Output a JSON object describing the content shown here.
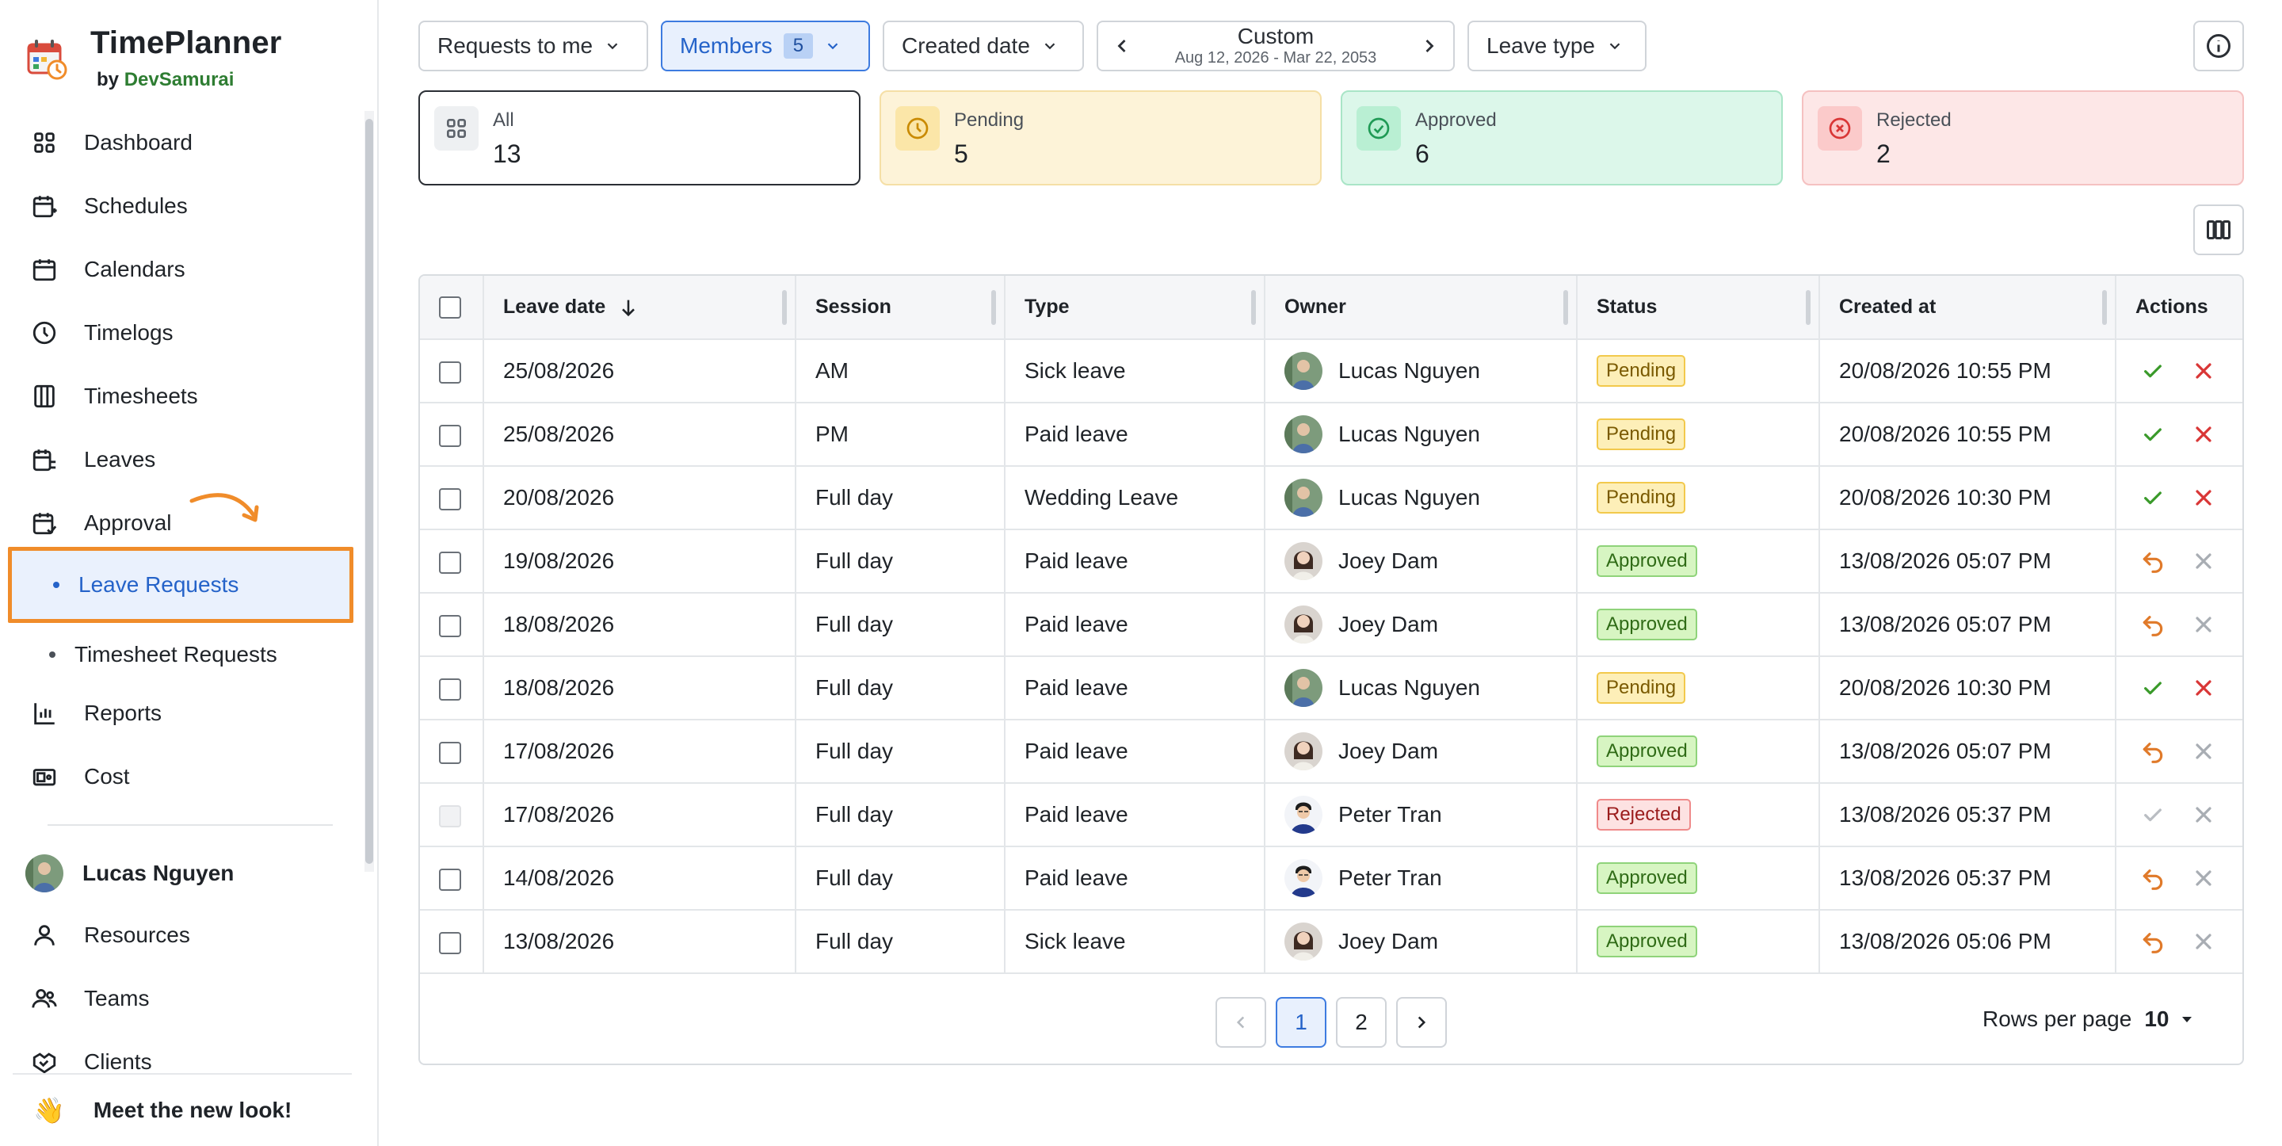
{
  "app": {
    "name": "TimePlanner",
    "by_prefix": "by",
    "by_brand": "DevSamurai"
  },
  "sidebar": {
    "items": [
      {
        "label": "Dashboard",
        "icon": "grid-icon"
      },
      {
        "label": "Schedules",
        "icon": "calendar-plus-icon"
      },
      {
        "label": "Calendars",
        "icon": "calendar-icon"
      },
      {
        "label": "Timelogs",
        "icon": "clock-icon"
      },
      {
        "label": "Timesheets",
        "icon": "columns-icon"
      },
      {
        "label": "Leaves",
        "icon": "calendar-leave-icon"
      },
      {
        "label": "Approval",
        "icon": "calendar-check-icon"
      }
    ],
    "sub_items": [
      {
        "label": "Leave Requests",
        "active": true
      },
      {
        "label": "Timesheet Requests",
        "active": false
      }
    ],
    "items2": [
      {
        "label": "Reports",
        "icon": "bar-chart-icon"
      },
      {
        "label": "Cost",
        "icon": "money-icon"
      }
    ],
    "user": {
      "name": "Lucas Nguyen"
    },
    "items3": [
      {
        "label": "Resources",
        "icon": "person-icon"
      },
      {
        "label": "Teams",
        "icon": "people-icon"
      },
      {
        "label": "Clients",
        "icon": "handshake-icon"
      }
    ],
    "new_look": "Meet the new look!",
    "new_look_emoji": "👋"
  },
  "filters": {
    "requests": "Requests to me",
    "members": "Members",
    "members_count": "5",
    "created_date": "Created date",
    "date_label": "Custom",
    "date_range": "Aug 12, 2026 - Mar 22, 2053",
    "leave_type": "Leave type"
  },
  "stats": [
    {
      "label": "All",
      "value": "13",
      "color": "#ffffff",
      "border": "#2b2f35"
    },
    {
      "label": "Pending",
      "value": "5",
      "color": "#fdf3d8",
      "border": "#f5dfa6"
    },
    {
      "label": "Approved",
      "value": "6",
      "color": "#dcf7ea",
      "border": "#a9e5c7"
    },
    {
      "label": "Rejected",
      "value": "2",
      "color": "#fde7e7",
      "border": "#f5c1c1"
    }
  ],
  "table": {
    "headers": {
      "leave_date": "Leave date",
      "session": "Session",
      "type": "Type",
      "owner": "Owner",
      "status": "Status",
      "created_at": "Created at",
      "actions": "Actions"
    },
    "rows": [
      {
        "leave_date": "25/08/2026",
        "session": "AM",
        "type": "Sick leave",
        "owner": "Lucas Nguyen",
        "avatar": "lucas",
        "status": "Pending",
        "created_at": "20/08/2026 10:55 PM",
        "actions": "approve-reject",
        "disabled": false
      },
      {
        "leave_date": "25/08/2026",
        "session": "PM",
        "type": "Paid leave",
        "owner": "Lucas Nguyen",
        "avatar": "lucas",
        "status": "Pending",
        "created_at": "20/08/2026 10:55 PM",
        "actions": "approve-reject",
        "disabled": false
      },
      {
        "leave_date": "20/08/2026",
        "session": "Full day",
        "type": "Wedding Leave",
        "owner": "Lucas Nguyen",
        "avatar": "lucas",
        "status": "Pending",
        "created_at": "20/08/2026 10:30 PM",
        "actions": "approve-reject",
        "disabled": false
      },
      {
        "leave_date": "19/08/2026",
        "session": "Full day",
        "type": "Paid leave",
        "owner": "Joey Dam",
        "avatar": "joey",
        "status": "Approved",
        "created_at": "13/08/2026 05:07 PM",
        "actions": "undo-reject",
        "disabled": false
      },
      {
        "leave_date": "18/08/2026",
        "session": "Full day",
        "type": "Paid leave",
        "owner": "Joey Dam",
        "avatar": "joey",
        "status": "Approved",
        "created_at": "13/08/2026 05:07 PM",
        "actions": "undo-reject",
        "disabled": false
      },
      {
        "leave_date": "18/08/2026",
        "session": "Full day",
        "type": "Paid leave",
        "owner": "Lucas Nguyen",
        "avatar": "lucas",
        "status": "Pending",
        "created_at": "20/08/2026 10:30 PM",
        "actions": "approve-reject",
        "disabled": false
      },
      {
        "leave_date": "17/08/2026",
        "session": "Full day",
        "type": "Paid leave",
        "owner": "Joey Dam",
        "avatar": "joey",
        "status": "Approved",
        "created_at": "13/08/2026 05:07 PM",
        "actions": "undo-reject",
        "disabled": false
      },
      {
        "leave_date": "17/08/2026",
        "session": "Full day",
        "type": "Paid leave",
        "owner": "Peter Tran",
        "avatar": "peter",
        "status": "Rejected",
        "created_at": "13/08/2026 05:37 PM",
        "actions": "disabled",
        "disabled": true
      },
      {
        "leave_date": "14/08/2026",
        "session": "Full day",
        "type": "Paid leave",
        "owner": "Peter Tran",
        "avatar": "peter",
        "status": "Approved",
        "created_at": "13/08/2026 05:37 PM",
        "actions": "undo-reject",
        "disabled": false
      },
      {
        "leave_date": "13/08/2026",
        "session": "Full day",
        "type": "Sick leave",
        "owner": "Joey Dam",
        "avatar": "joey",
        "status": "Approved",
        "created_at": "13/08/2026 05:06 PM",
        "actions": "undo-reject",
        "disabled": false
      }
    ]
  },
  "pagination": {
    "pages": [
      "1",
      "2"
    ],
    "current": "1",
    "rows_per_page_label": "Rows per page",
    "rows_per_page": "10"
  },
  "colors": {
    "accent": "#2563c9",
    "highlight": "#f08c2a",
    "approve": "#3a9a2a",
    "reject": "#d93636",
    "undo": "#e07a2a"
  }
}
